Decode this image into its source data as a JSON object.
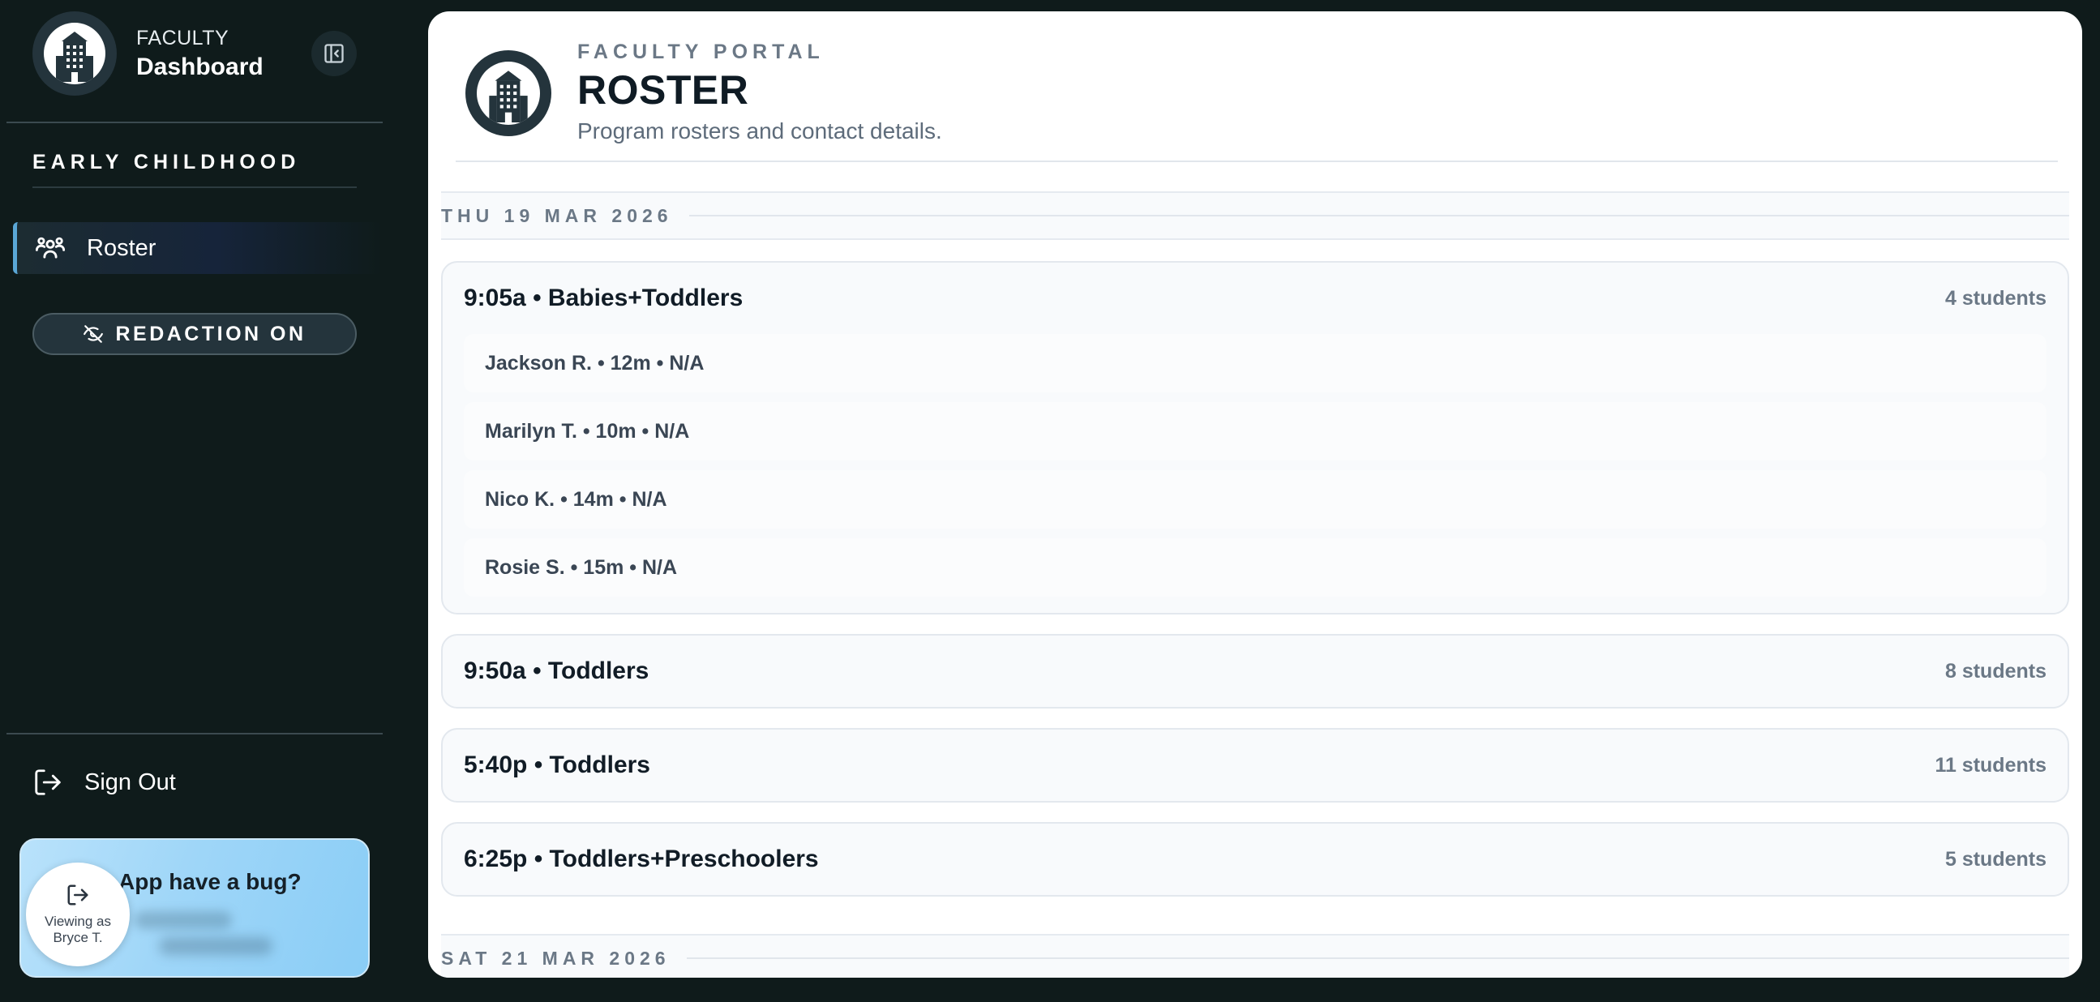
{
  "sidebar": {
    "brand": {
      "eyebrow": "FACULTY",
      "title": "Dashboard"
    },
    "section_label": "EARLY CHILDHOOD",
    "nav": [
      {
        "label": "Roster",
        "icon": "users-icon",
        "active": true
      }
    ],
    "redaction_label": "REDACTION ON",
    "sign_out_label": "Sign Out",
    "bug_card": {
      "title": "App have a bug?"
    },
    "viewing_badge": {
      "line1": "Viewing as",
      "line2": "Bryce T."
    }
  },
  "header": {
    "eyebrow": "FACULTY PORTAL",
    "title": "ROSTER",
    "subtitle": "Program rosters and contact details."
  },
  "days": [
    {
      "date_label": "THU 19 MAR 2026",
      "sessions": [
        {
          "title": "9:05a • Babies+Toddlers",
          "count": "4 students",
          "expanded": true,
          "students": [
            "Jackson R. • 12m • N/A",
            "Marilyn T. • 10m • N/A",
            "Nico K. • 14m • N/A",
            "Rosie S. • 15m • N/A"
          ]
        },
        {
          "title": "9:50a • Toddlers",
          "count": "8 students",
          "expanded": false
        },
        {
          "title": "5:40p • Toddlers",
          "count": "11 students",
          "expanded": false
        },
        {
          "title": "6:25p • Toddlers+Preschoolers",
          "count": "5 students",
          "expanded": false
        }
      ]
    },
    {
      "date_label": "SAT 21 MAR 2026",
      "sessions": []
    }
  ],
  "colors": {
    "sidebar_bg": "#0f1b1b",
    "accent": "#5aa7d6",
    "bug_card_bg": "#9fd6f8",
    "panel_bg": "#ffffff"
  }
}
